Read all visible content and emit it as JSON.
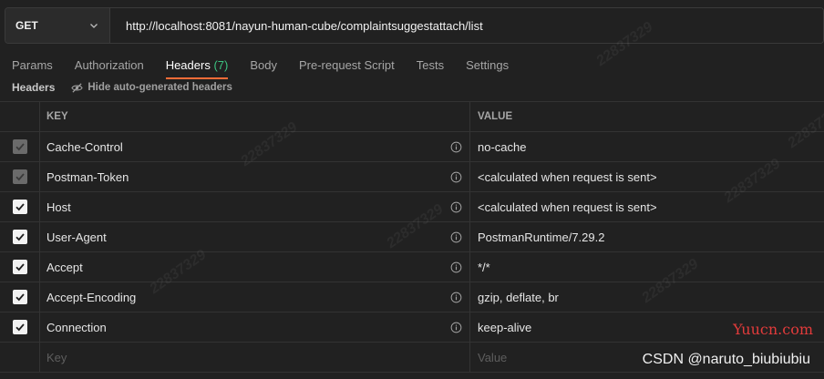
{
  "request": {
    "method": "GET",
    "url": "http://localhost:8081/nayun-human-cube/complaintsuggestattach/list"
  },
  "tabs": [
    {
      "label": "Params",
      "active": false
    },
    {
      "label": "Authorization",
      "active": false
    },
    {
      "label": "Headers",
      "count": "(7)",
      "active": true
    },
    {
      "label": "Body",
      "active": false
    },
    {
      "label": "Pre-request Script",
      "active": false
    },
    {
      "label": "Tests",
      "active": false
    },
    {
      "label": "Settings",
      "active": false
    }
  ],
  "subheader": {
    "title": "Headers",
    "hide_auto_label": "Hide auto-generated headers"
  },
  "table": {
    "columns": {
      "key": "KEY",
      "value": "VALUE"
    },
    "rows": [
      {
        "key": "Cache-Control",
        "value": "no-cache",
        "checked": true,
        "disabled": true
      },
      {
        "key": "Postman-Token",
        "value": "<calculated when request is sent>",
        "checked": true,
        "disabled": true
      },
      {
        "key": "Host",
        "value": "<calculated when request is sent>",
        "checked": true,
        "disabled": false
      },
      {
        "key": "User-Agent",
        "value": "PostmanRuntime/7.29.2",
        "checked": true,
        "disabled": false
      },
      {
        "key": "Accept",
        "value": "*/*",
        "checked": true,
        "disabled": false
      },
      {
        "key": "Accept-Encoding",
        "value": "gzip, deflate, br",
        "checked": true,
        "disabled": false
      },
      {
        "key": "Connection",
        "value": "keep-alive",
        "checked": true,
        "disabled": false
      }
    ],
    "new_row": {
      "key_placeholder": "Key",
      "value_placeholder": "Value"
    }
  },
  "watermarks": {
    "brand": "Yuucn.com",
    "csdn": "CSDN @naruto_biubiubiu",
    "diagonal": "22837329"
  },
  "colors": {
    "background": "#212121",
    "accent": "#ff6c37",
    "count": "#3cc380",
    "brand_mark": "#e23b3b"
  },
  "icons": {
    "method_dropdown": "chevron-down-icon",
    "hide_auto": "eye-off-icon",
    "checkbox": "check-icon",
    "info": "info-icon"
  }
}
